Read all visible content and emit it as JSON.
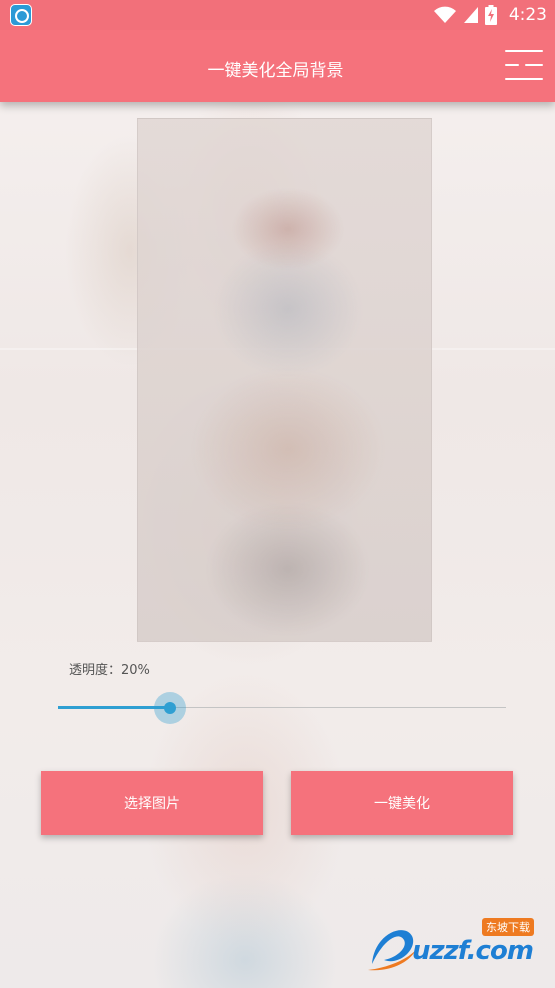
{
  "status_bar": {
    "time": "4:23",
    "icons": [
      "app-notification-icon",
      "wifi-icon",
      "signal-icon",
      "battery-charging-icon"
    ]
  },
  "toolbar": {
    "title": "一键美化全局背景",
    "menu_icon": "menu-icon"
  },
  "opacity": {
    "label": "透明度：20%",
    "value": 0.25
  },
  "buttons": {
    "pick_image": "选择图片",
    "beautify": "一键美化"
  },
  "watermark": {
    "brand": "uzzf.com",
    "badge": "东坡下载"
  },
  "colors": {
    "primary": "#f5727c",
    "status_bar": "#f2707a",
    "accent": "#2f9fd2",
    "watermark_blue": "#1e7fd4",
    "watermark_orange": "#ee7a21"
  }
}
